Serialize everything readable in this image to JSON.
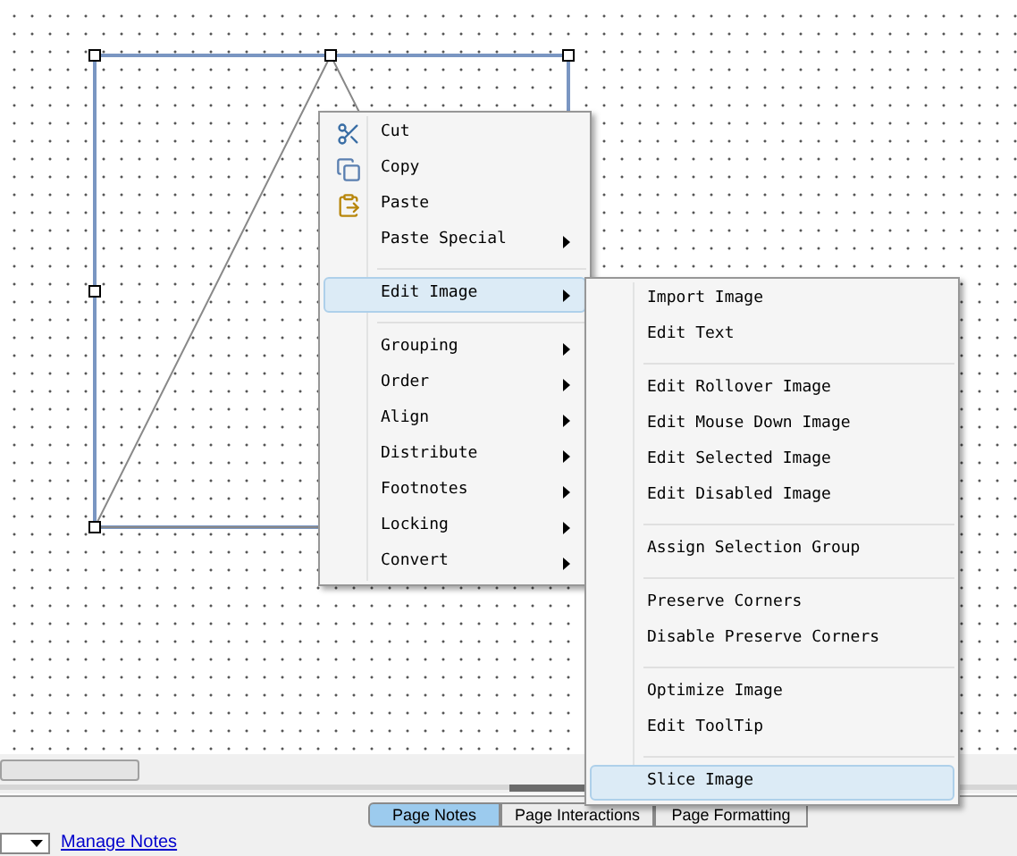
{
  "context_menu": {
    "items": [
      {
        "kind": "item",
        "label": "Cut",
        "submenu": false,
        "selected": false
      },
      {
        "kind": "item",
        "label": "Copy",
        "submenu": false,
        "selected": false
      },
      {
        "kind": "item",
        "label": "Paste",
        "submenu": false,
        "selected": false
      },
      {
        "kind": "item",
        "label": "Paste Special",
        "submenu": true,
        "selected": false
      },
      {
        "kind": "separator"
      },
      {
        "kind": "item",
        "label": "Edit Image",
        "submenu": true,
        "selected": true
      },
      {
        "kind": "separator"
      },
      {
        "kind": "item",
        "label": "Grouping",
        "submenu": true,
        "selected": false
      },
      {
        "kind": "item",
        "label": "Order",
        "submenu": true,
        "selected": false
      },
      {
        "kind": "item",
        "label": "Align",
        "submenu": true,
        "selected": false
      },
      {
        "kind": "item",
        "label": "Distribute",
        "submenu": true,
        "selected": false
      },
      {
        "kind": "item",
        "label": "Footnotes",
        "submenu": true,
        "selected": false
      },
      {
        "kind": "item",
        "label": "Locking",
        "submenu": true,
        "selected": false
      },
      {
        "kind": "item",
        "label": "Convert",
        "submenu": true,
        "selected": false
      }
    ]
  },
  "submenu": {
    "items": [
      {
        "kind": "item",
        "label": "Import Image",
        "selected": false
      },
      {
        "kind": "item",
        "label": "Edit Text",
        "selected": false
      },
      {
        "kind": "separator"
      },
      {
        "kind": "item",
        "label": "Edit Rollover Image",
        "selected": false
      },
      {
        "kind": "item",
        "label": "Edit Mouse Down Image",
        "selected": false
      },
      {
        "kind": "item",
        "label": "Edit Selected Image",
        "selected": false
      },
      {
        "kind": "item",
        "label": "Edit Disabled Image",
        "selected": false
      },
      {
        "kind": "separator"
      },
      {
        "kind": "item",
        "label": "Assign Selection Group",
        "selected": false
      },
      {
        "kind": "separator"
      },
      {
        "kind": "item",
        "label": "Preserve Corners",
        "selected": false
      },
      {
        "kind": "item",
        "label": "Disable Preserve Corners",
        "selected": false
      },
      {
        "kind": "separator"
      },
      {
        "kind": "item",
        "label": "Optimize Image",
        "selected": false
      },
      {
        "kind": "item",
        "label": "Edit ToolTip",
        "selected": false
      },
      {
        "kind": "separator"
      },
      {
        "kind": "item",
        "label": "Slice Image",
        "selected": true
      }
    ]
  },
  "tabs": [
    {
      "label": "Page Notes",
      "selected": true
    },
    {
      "label": "Page Interactions",
      "selected": false
    },
    {
      "label": "Page Formatting",
      "selected": false
    }
  ],
  "notes_bar": {
    "link": "Manage Notes"
  }
}
